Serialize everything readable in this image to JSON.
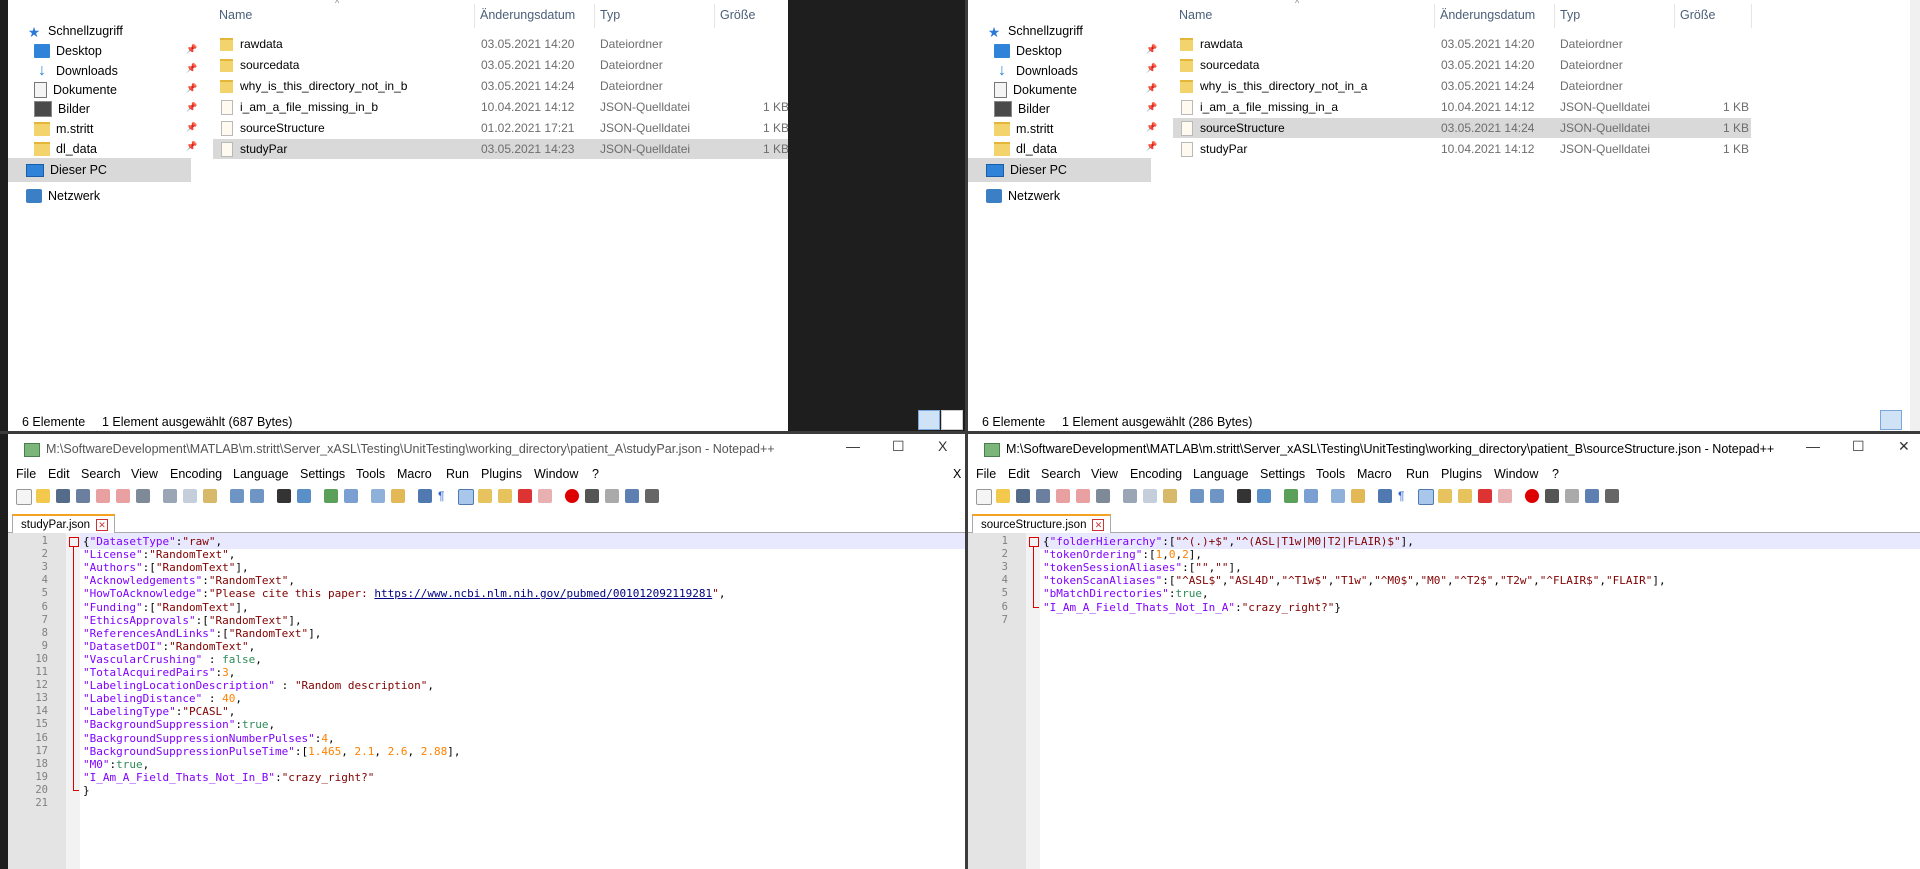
{
  "nav": {
    "quick_access": "Schnellzugriff",
    "items": [
      {
        "label": "Desktop",
        "icon": "desktop-icon"
      },
      {
        "label": "Downloads",
        "icon": "download-icon"
      },
      {
        "label": "Dokumente",
        "icon": "documents-icon"
      },
      {
        "label": "Bilder",
        "icon": "pictures-icon"
      },
      {
        "label": "m.stritt",
        "icon": "folder-icon"
      },
      {
        "label": "dl_data",
        "icon": "folder-icon"
      }
    ],
    "this_pc": "Dieser PC",
    "network": "Netzwerk",
    "pin_glyph": "📌"
  },
  "columns": {
    "name": "Name",
    "date": "Änderungsdatum",
    "type": "Typ",
    "size": "Größe"
  },
  "explorer_left": {
    "files": [
      {
        "name": "rawdata",
        "date": "03.05.2021 14:20",
        "type": "Dateiordner",
        "size": ""
      },
      {
        "name": "sourcedata",
        "date": "03.05.2021 14:20",
        "type": "Dateiordner",
        "size": ""
      },
      {
        "name": "why_is_this_directory_not_in_b",
        "date": "03.05.2021 14:24",
        "type": "Dateiordner",
        "size": ""
      },
      {
        "name": "i_am_a_file_missing_in_b",
        "date": "10.04.2021 14:12",
        "type": "JSON-Quelldatei",
        "size": "1 KB"
      },
      {
        "name": "sourceStructure",
        "date": "01.02.2021 17:21",
        "type": "JSON-Quelldatei",
        "size": "1 KB"
      },
      {
        "name": "studyPar",
        "date": "03.05.2021 14:23",
        "type": "JSON-Quelldatei",
        "size": "1 KB"
      }
    ],
    "status_count": "6 Elemente",
    "status_sel": "1 Element ausgewählt (687 Bytes)"
  },
  "explorer_right": {
    "files": [
      {
        "name": "rawdata",
        "date": "03.05.2021 14:20",
        "type": "Dateiordner",
        "size": ""
      },
      {
        "name": "sourcedata",
        "date": "03.05.2021 14:20",
        "type": "Dateiordner",
        "size": ""
      },
      {
        "name": "why_is_this_directory_not_in_a",
        "date": "03.05.2021 14:24",
        "type": "Dateiordner",
        "size": ""
      },
      {
        "name": "i_am_a_file_missing_in_a",
        "date": "10.04.2021 14:12",
        "type": "JSON-Quelldatei",
        "size": "1 KB"
      },
      {
        "name": "sourceStructure",
        "date": "03.05.2021 14:24",
        "type": "JSON-Quelldatei",
        "size": "1 KB"
      },
      {
        "name": "studyPar",
        "date": "10.04.2021 14:12",
        "type": "JSON-Quelldatei",
        "size": "1 KB"
      }
    ],
    "status_count": "6 Elemente",
    "status_sel": "1 Element ausgewählt (286 Bytes)"
  },
  "menu": [
    "File",
    "Edit",
    "Search",
    "View",
    "Encoding",
    "Language",
    "Settings",
    "Tools",
    "Macro",
    "Run",
    "Plugins",
    "Window",
    "?"
  ],
  "notepad_left": {
    "title": "M:\\SoftwareDevelopment\\MATLAB\\m.stritt\\Server_xASL\\Testing\\UnitTesting\\working_directory\\patient_A\\studyPar.json - Notepad++",
    "tab": "studyPar.json",
    "win_min": "—",
    "win_max": "☐",
    "win_close": "X",
    "close_x": "X"
  },
  "notepad_right": {
    "title": "M:\\SoftwareDevelopment\\MATLAB\\m.stritt\\Server_xASL\\Testing\\UnitTesting\\working_directory\\patient_B\\sourceStructure.json - Notepad++",
    "tab": "sourceStructure.json",
    "win_min": "—",
    "win_max": "☐",
    "win_close": "✕"
  },
  "code_left": [
    [
      [
        "p",
        "{"
      ],
      [
        "k",
        "\"DatasetType\""
      ],
      [
        "p",
        ":"
      ],
      [
        "s",
        "\"raw\""
      ],
      [
        "p",
        ","
      ]
    ],
    [
      [
        "k",
        "\"License\""
      ],
      [
        "p",
        ":"
      ],
      [
        "s",
        "\"RandomText\""
      ],
      [
        "p",
        ","
      ]
    ],
    [
      [
        "k",
        "\"Authors\""
      ],
      [
        "p",
        ":["
      ],
      [
        "s",
        "\"RandomText\""
      ],
      [
        "p",
        "],"
      ]
    ],
    [
      [
        "k",
        "\"Acknowledgements\""
      ],
      [
        "p",
        ":"
      ],
      [
        "s",
        "\"RandomText\""
      ],
      [
        "p",
        ","
      ]
    ],
    [
      [
        "k",
        "\"HowToAcknowledge\""
      ],
      [
        "p",
        ":"
      ],
      [
        "s",
        "\"Please cite this paper: "
      ],
      [
        "lnk",
        "https://www.ncbi.nlm.nih.gov/pubmed/001012092119281"
      ],
      [
        "s",
        "\""
      ],
      [
        "p",
        ","
      ]
    ],
    [
      [
        "k",
        "\"Funding\""
      ],
      [
        "p",
        ":["
      ],
      [
        "s",
        "\"RandomText\""
      ],
      [
        "p",
        "],"
      ]
    ],
    [
      [
        "k",
        "\"EthicsApprovals\""
      ],
      [
        "p",
        ":["
      ],
      [
        "s",
        "\"RandomText\""
      ],
      [
        "p",
        "],"
      ]
    ],
    [
      [
        "k",
        "\"ReferencesAndLinks\""
      ],
      [
        "p",
        ":["
      ],
      [
        "s",
        "\"RandomText\""
      ],
      [
        "p",
        "],"
      ]
    ],
    [
      [
        "k",
        "\"DatasetDOI\""
      ],
      [
        "p",
        ":"
      ],
      [
        "s",
        "\"RandomText\""
      ],
      [
        "p",
        ","
      ]
    ],
    [
      [
        "k",
        "\"VascularCrushing\""
      ],
      [
        "p",
        " : "
      ],
      [
        "t",
        "false"
      ],
      [
        "p",
        ","
      ]
    ],
    [
      [
        "k",
        "\"TotalAcquiredPairs\""
      ],
      [
        "p",
        ":"
      ],
      [
        "n",
        "3"
      ],
      [
        "p",
        ","
      ]
    ],
    [
      [
        "k",
        "\"LabelingLocationDescription\""
      ],
      [
        "p",
        " : "
      ],
      [
        "s",
        "\"Random description\""
      ],
      [
        "p",
        ","
      ]
    ],
    [
      [
        "k",
        "\"LabelingDistance\""
      ],
      [
        "p",
        " : "
      ],
      [
        "n",
        "40"
      ],
      [
        "p",
        ","
      ]
    ],
    [
      [
        "k",
        "\"LabelingType\""
      ],
      [
        "p",
        ":"
      ],
      [
        "s",
        "\"PCASL\""
      ],
      [
        "p",
        ","
      ]
    ],
    [
      [
        "k",
        "\"BackgroundSuppression\""
      ],
      [
        "p",
        ":"
      ],
      [
        "t",
        "true"
      ],
      [
        "p",
        ","
      ]
    ],
    [
      [
        "k",
        "\"BackgroundSuppressionNumberPulses\""
      ],
      [
        "p",
        ":"
      ],
      [
        "n",
        "4"
      ],
      [
        "p",
        ","
      ]
    ],
    [
      [
        "k",
        "\"BackgroundSuppressionPulseTime\""
      ],
      [
        "p",
        ":["
      ],
      [
        "n",
        "1.465"
      ],
      [
        "p",
        ", "
      ],
      [
        "n",
        "2.1"
      ],
      [
        "p",
        ", "
      ],
      [
        "n",
        "2.6"
      ],
      [
        "p",
        ", "
      ],
      [
        "n",
        "2.88"
      ],
      [
        "p",
        "],"
      ]
    ],
    [
      [
        "k",
        "\"M0\""
      ],
      [
        "p",
        ":"
      ],
      [
        "t",
        "true"
      ],
      [
        "p",
        ","
      ]
    ],
    [
      [
        "k",
        "\"I_Am_A_Field_Thats_Not_In_B\""
      ],
      [
        "p",
        ":"
      ],
      [
        "s",
        "\"crazy_right?\""
      ]
    ],
    [
      [
        "p",
        "}"
      ]
    ],
    []
  ],
  "code_right": [
    [
      [
        "p",
        "{"
      ],
      [
        "k",
        "\"folderHierarchy\""
      ],
      [
        "p",
        ":["
      ],
      [
        "s",
        "\"^(.)+$\""
      ],
      [
        "p",
        ","
      ],
      [
        "s",
        "\"^(ASL|T1w|M0|T2|FLAIR)$\""
      ],
      [
        "p",
        "],"
      ]
    ],
    [
      [
        "k",
        "\"tokenOrdering\""
      ],
      [
        "p",
        ":["
      ],
      [
        "n",
        "1"
      ],
      [
        "p",
        ","
      ],
      [
        "n",
        "0"
      ],
      [
        "p",
        ","
      ],
      [
        "n",
        "2"
      ],
      [
        "p",
        "],"
      ]
    ],
    [
      [
        "k",
        "\"tokenSessionAliases\""
      ],
      [
        "p",
        ":["
      ],
      [
        "s",
        "\"\""
      ],
      [
        "p",
        ","
      ],
      [
        "s",
        "\"\""
      ],
      [
        "p",
        "],"
      ]
    ],
    [
      [
        "k",
        "\"tokenScanAliases\""
      ],
      [
        "p",
        ":["
      ],
      [
        "s",
        "\"^ASL$\""
      ],
      [
        "p",
        ","
      ],
      [
        "s",
        "\"ASL4D\""
      ],
      [
        "p",
        ","
      ],
      [
        "s",
        "\"^T1w$\""
      ],
      [
        "p",
        ","
      ],
      [
        "s",
        "\"T1w\""
      ],
      [
        "p",
        ","
      ],
      [
        "s",
        "\"^M0$\""
      ],
      [
        "p",
        ","
      ],
      [
        "s",
        "\"M0\""
      ],
      [
        "p",
        ","
      ],
      [
        "s",
        "\"^T2$\""
      ],
      [
        "p",
        ","
      ],
      [
        "s",
        "\"T2w\""
      ],
      [
        "p",
        ","
      ],
      [
        "s",
        "\"^FLAIR$\""
      ],
      [
        "p",
        ","
      ],
      [
        "s",
        "\"FLAIR\""
      ],
      [
        "p",
        "],"
      ]
    ],
    [
      [
        "k",
        "\"bMatchDirectories\""
      ],
      [
        "p",
        ":"
      ],
      [
        "t",
        "true"
      ],
      [
        "p",
        ","
      ]
    ],
    [
      [
        "k",
        "\"I_Am_A_Field_Thats_Not_In_A\""
      ],
      [
        "p",
        ":"
      ],
      [
        "s",
        "\"crazy_right?\""
      ],
      [
        "p",
        "}"
      ]
    ],
    []
  ],
  "colors": {
    "fold_marker": "#dd0000",
    "tab_accent": "#f4a21f",
    "selection": "#d9d9d9"
  }
}
